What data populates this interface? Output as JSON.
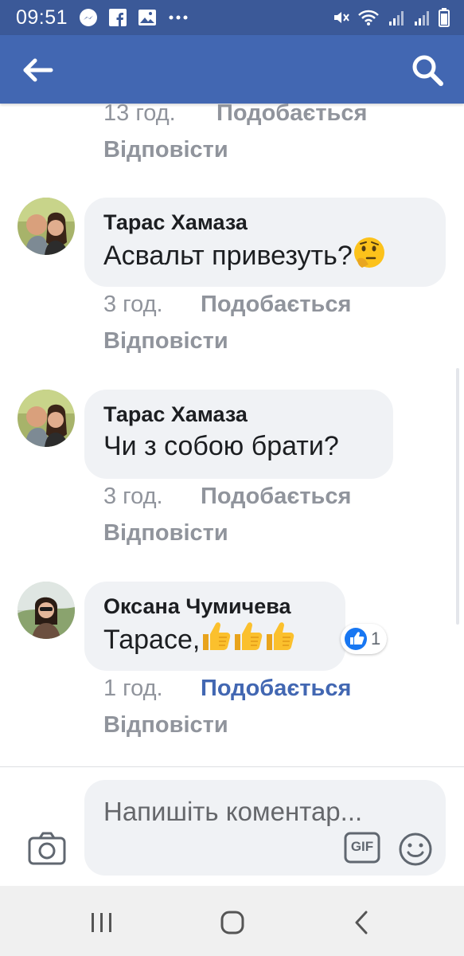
{
  "statusbar": {
    "time": "09:51",
    "icons_left": [
      "messenger-icon",
      "facebook-icon",
      "gallery-icon",
      "more-dots-icon"
    ],
    "icons_right": [
      "mute-icon",
      "wifi-icon",
      "signal-icon",
      "signal-icon",
      "battery-icon"
    ]
  },
  "header": {
    "back_icon": "arrow-left-icon",
    "search_icon": "search-icon",
    "background": "#4267b2"
  },
  "comments": [
    {
      "author": "",
      "text": "",
      "time": "13 год.",
      "like_label": "Подобається",
      "reply_label": "Відповісти",
      "liked": false
    },
    {
      "author": "Тарас Хамаза",
      "text": "Асвальт привезуть?",
      "emoji": "thinking-face-emoji",
      "time": "3 год.",
      "like_label": "Подобається",
      "reply_label": "Відповісти",
      "liked": false
    },
    {
      "author": "Тарас Хамаза",
      "text": "Чи з собою брати?",
      "time": "3 год.",
      "like_label": "Подобається",
      "reply_label": "Відповісти",
      "liked": false
    },
    {
      "author": "Оксана Чумичева",
      "text": "Тарасе,",
      "emoji": "thumbs-up-emoji x3",
      "time": "1 год.",
      "like_label": "Подобається",
      "reply_label": "Відповісти",
      "liked": true,
      "reaction_count": "1"
    }
  ],
  "composer": {
    "placeholder": "Напишіть коментар...",
    "camera_icon": "camera-icon",
    "gif_label": "GIF",
    "emoji_icon": "smiley-icon"
  },
  "navbar": {
    "buttons": [
      "recent-apps-icon",
      "home-icon",
      "back-icon"
    ]
  },
  "colors": {
    "statusbar": "#3b5998",
    "header": "#4267b2",
    "bubble": "#f0f2f5",
    "meta_text": "#90949c",
    "like_active": "#4267b2"
  }
}
